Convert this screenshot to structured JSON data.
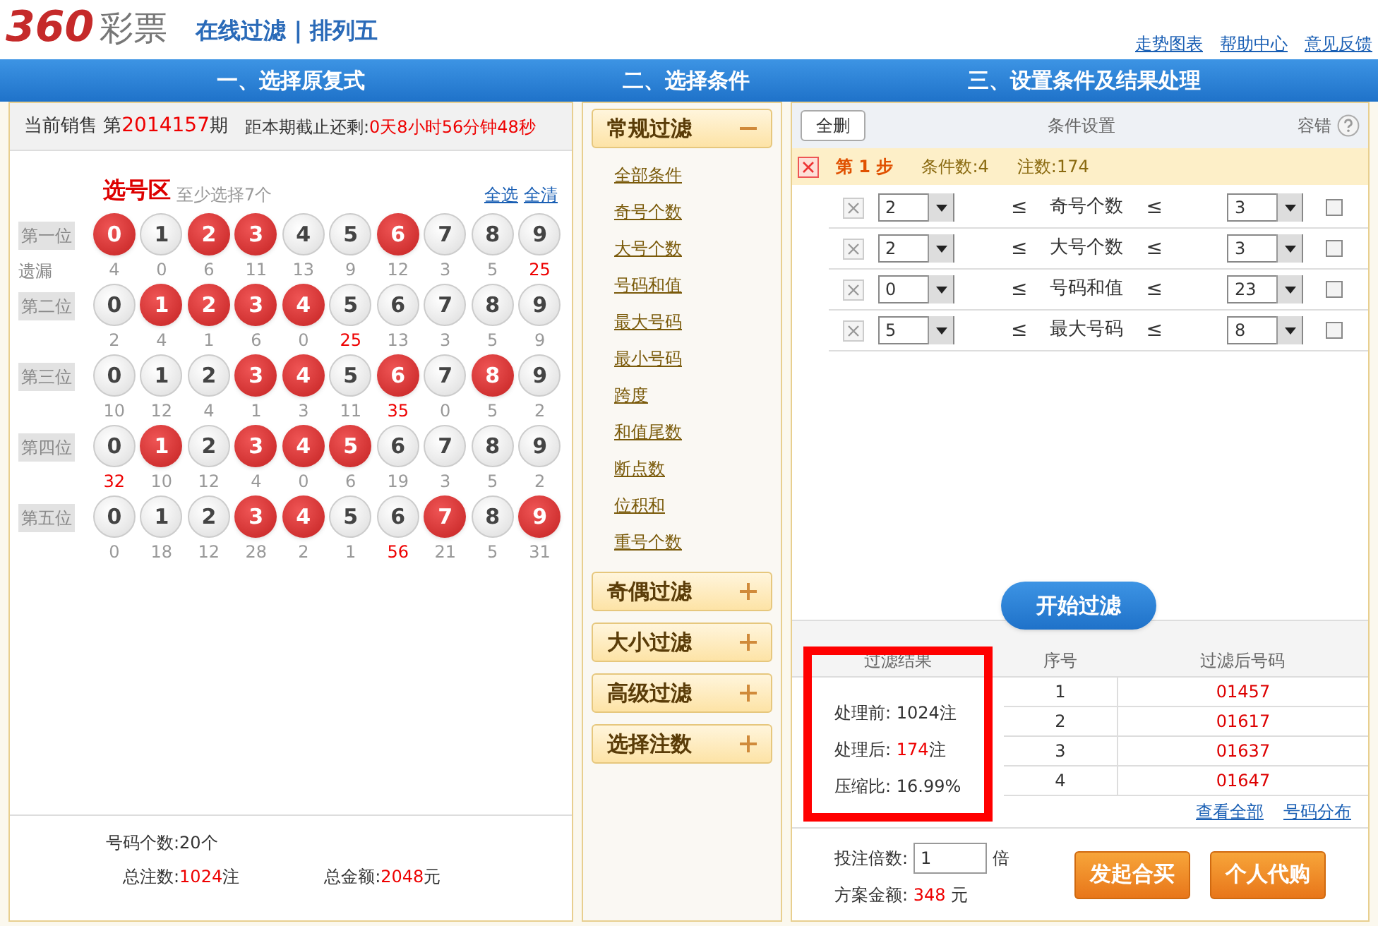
{
  "header": {
    "logo_number": "360",
    "logo_text": "彩票",
    "subtitle": "在线过滤 | 排列五",
    "links": [
      "走势图表",
      "帮助中心",
      "意见反馈"
    ]
  },
  "steps": [
    {
      "label": "一、选择原复式"
    },
    {
      "label": "二、选择条件"
    },
    {
      "label": "三、设置条件及结果处理"
    }
  ],
  "sale": {
    "prefix": "当前销售 第",
    "issue": "2014157",
    "suffix": "期",
    "deadline_label": "距本期截止还剩:",
    "deadline": "0天8小时56分钟48秒"
  },
  "pick": {
    "title": "选号区",
    "hint": "至少选择7个",
    "select_all": "全选",
    "clear_all": "全清",
    "miss_label": "遗漏",
    "rows": [
      {
        "label": "第一位",
        "balls": [
          {
            "n": "0",
            "selected": true,
            "miss": "4",
            "hot": false
          },
          {
            "n": "1",
            "selected": false,
            "miss": "0",
            "hot": false
          },
          {
            "n": "2",
            "selected": true,
            "miss": "6",
            "hot": false
          },
          {
            "n": "3",
            "selected": true,
            "miss": "11",
            "hot": false
          },
          {
            "n": "4",
            "selected": false,
            "miss": "13",
            "hot": false
          },
          {
            "n": "5",
            "selected": false,
            "miss": "9",
            "hot": false
          },
          {
            "n": "6",
            "selected": true,
            "miss": "12",
            "hot": false
          },
          {
            "n": "7",
            "selected": false,
            "miss": "3",
            "hot": false
          },
          {
            "n": "8",
            "selected": false,
            "miss": "5",
            "hot": false
          },
          {
            "n": "9",
            "selected": false,
            "miss": "25",
            "hot": true
          }
        ]
      },
      {
        "label": "第二位",
        "balls": [
          {
            "n": "0",
            "selected": false,
            "miss": "2",
            "hot": false
          },
          {
            "n": "1",
            "selected": true,
            "miss": "4",
            "hot": false
          },
          {
            "n": "2",
            "selected": true,
            "miss": "1",
            "hot": false
          },
          {
            "n": "3",
            "selected": true,
            "miss": "6",
            "hot": false
          },
          {
            "n": "4",
            "selected": true,
            "miss": "0",
            "hot": false
          },
          {
            "n": "5",
            "selected": false,
            "miss": "25",
            "hot": true
          },
          {
            "n": "6",
            "selected": false,
            "miss": "13",
            "hot": false
          },
          {
            "n": "7",
            "selected": false,
            "miss": "3",
            "hot": false
          },
          {
            "n": "8",
            "selected": false,
            "miss": "5",
            "hot": false
          },
          {
            "n": "9",
            "selected": false,
            "miss": "9",
            "hot": false
          }
        ]
      },
      {
        "label": "第三位",
        "balls": [
          {
            "n": "0",
            "selected": false,
            "miss": "10",
            "hot": false
          },
          {
            "n": "1",
            "selected": false,
            "miss": "12",
            "hot": false
          },
          {
            "n": "2",
            "selected": false,
            "miss": "4",
            "hot": false
          },
          {
            "n": "3",
            "selected": true,
            "miss": "1",
            "hot": false
          },
          {
            "n": "4",
            "selected": true,
            "miss": "3",
            "hot": false
          },
          {
            "n": "5",
            "selected": false,
            "miss": "11",
            "hot": false
          },
          {
            "n": "6",
            "selected": true,
            "miss": "35",
            "hot": true
          },
          {
            "n": "7",
            "selected": false,
            "miss": "0",
            "hot": false
          },
          {
            "n": "8",
            "selected": true,
            "miss": "5",
            "hot": false
          },
          {
            "n": "9",
            "selected": false,
            "miss": "2",
            "hot": false
          }
        ]
      },
      {
        "label": "第四位",
        "balls": [
          {
            "n": "0",
            "selected": false,
            "miss": "32",
            "hot": true
          },
          {
            "n": "1",
            "selected": true,
            "miss": "10",
            "hot": false
          },
          {
            "n": "2",
            "selected": false,
            "miss": "12",
            "hot": false
          },
          {
            "n": "3",
            "selected": true,
            "miss": "4",
            "hot": false
          },
          {
            "n": "4",
            "selected": true,
            "miss": "0",
            "hot": false
          },
          {
            "n": "5",
            "selected": true,
            "miss": "6",
            "hot": false
          },
          {
            "n": "6",
            "selected": false,
            "miss": "19",
            "hot": false
          },
          {
            "n": "7",
            "selected": false,
            "miss": "3",
            "hot": false
          },
          {
            "n": "8",
            "selected": false,
            "miss": "5",
            "hot": false
          },
          {
            "n": "9",
            "selected": false,
            "miss": "2",
            "hot": false
          }
        ]
      },
      {
        "label": "第五位",
        "balls": [
          {
            "n": "0",
            "selected": false,
            "miss": "0",
            "hot": false
          },
          {
            "n": "1",
            "selected": false,
            "miss": "18",
            "hot": false
          },
          {
            "n": "2",
            "selected": false,
            "miss": "12",
            "hot": false
          },
          {
            "n": "3",
            "selected": true,
            "miss": "28",
            "hot": false
          },
          {
            "n": "4",
            "selected": true,
            "miss": "2",
            "hot": false
          },
          {
            "n": "5",
            "selected": false,
            "miss": "1",
            "hot": false
          },
          {
            "n": "6",
            "selected": false,
            "miss": "56",
            "hot": true
          },
          {
            "n": "7",
            "selected": true,
            "miss": "21",
            "hot": false
          },
          {
            "n": "8",
            "selected": false,
            "miss": "5",
            "hot": false
          },
          {
            "n": "9",
            "selected": true,
            "miss": "31",
            "hot": false
          }
        ]
      }
    ]
  },
  "totals": {
    "count_label": "号码个数:",
    "count": "20个",
    "bets_label": "总注数:",
    "bets": "1024",
    "bets_unit": "注",
    "amount_label": "总金额:",
    "amount": "2048",
    "amount_unit": "元"
  },
  "filters": [
    {
      "title": "常规过滤",
      "expanded": true,
      "items": [
        "全部条件",
        "奇号个数",
        "大号个数",
        "号码和值",
        "最大号码",
        "最小号码",
        "跨度",
        "和值尾数",
        "断点数",
        "位积和",
        "重号个数"
      ]
    },
    {
      "title": "奇偶过滤",
      "expanded": false
    },
    {
      "title": "大小过滤",
      "expanded": false
    },
    {
      "title": "高级过滤",
      "expanded": false
    },
    {
      "title": "选择注数",
      "expanded": false
    }
  ],
  "conditions": {
    "delete_all": "全删",
    "title": "条件设置",
    "tolerance": "容错",
    "step": {
      "label": "第 1 步",
      "count": "条件数:4",
      "bets": "注数:174"
    },
    "rows": [
      {
        "min": "2",
        "op1": "≤",
        "name": "奇号个数",
        "op2": "≤",
        "max": "3",
        "checked": false
      },
      {
        "min": "2",
        "op1": "≤",
        "name": "大号个数",
        "op2": "≤",
        "max": "3",
        "checked": false
      },
      {
        "min": "0",
        "op1": "≤",
        "name": "号码和值",
        "op2": "≤",
        "max": "23",
        "checked": false
      },
      {
        "min": "5",
        "op1": "≤",
        "name": "最大号码",
        "op2": "≤",
        "max": "8",
        "checked": false
      }
    ]
  },
  "start_button": "开始过滤",
  "results": {
    "columns": [
      "过滤结果",
      "序号",
      "过滤后号码"
    ],
    "before_label": "处理前:",
    "before": "1024注",
    "after_label": "处理后:",
    "after": "174",
    "after_unit": "注",
    "ratio_label": "压缩比:",
    "ratio": "16.99%",
    "rows": [
      {
        "index": "1",
        "number": "01457"
      },
      {
        "index": "2",
        "number": "01617"
      },
      {
        "index": "3",
        "number": "01637"
      },
      {
        "index": "4",
        "number": "01647"
      }
    ],
    "links": [
      "查看全部",
      "号码分布"
    ]
  },
  "order": {
    "multiple_label": "投注倍数:",
    "multiple": "1",
    "multiple_unit": "倍",
    "amount_label": "方案金额:",
    "amount": "348",
    "amount_unit": "元",
    "buttons": [
      "发起合买",
      "个人代购"
    ]
  }
}
